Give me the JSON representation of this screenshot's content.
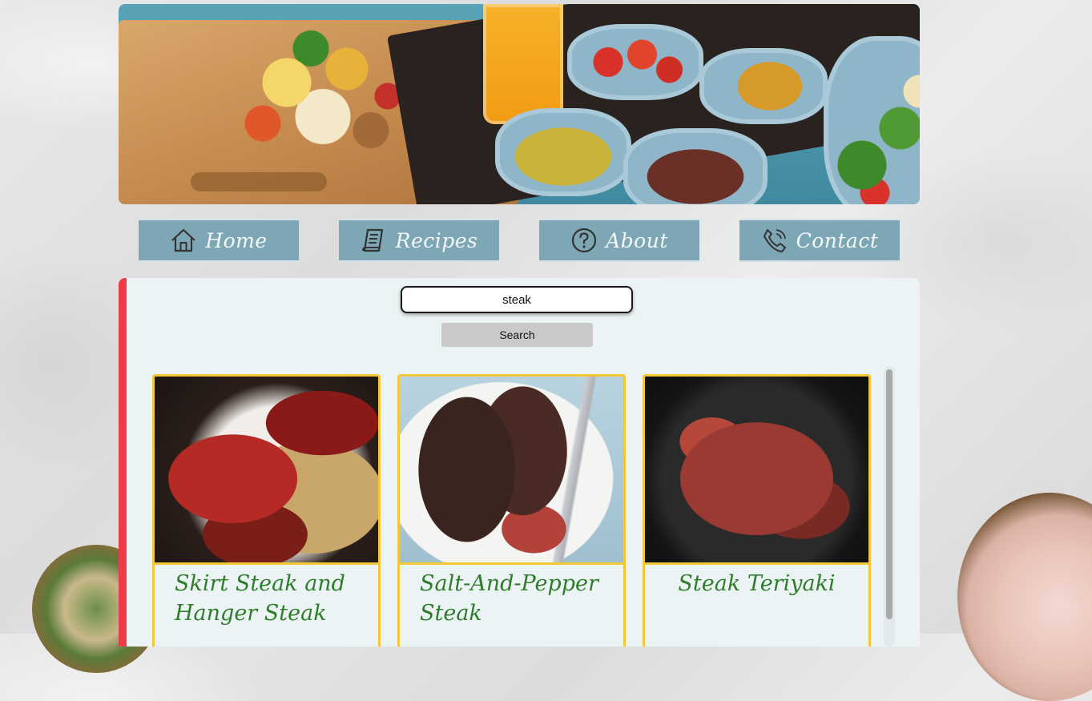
{
  "nav": {
    "items": [
      {
        "label": "Home",
        "icon": "home-icon"
      },
      {
        "label": "Recipes",
        "icon": "recipe-icon"
      },
      {
        "label": "About",
        "icon": "question-icon"
      },
      {
        "label": "Contact",
        "icon": "phone-icon"
      }
    ]
  },
  "search": {
    "value": "steak",
    "button_label": "Search"
  },
  "results": [
    {
      "title": "Skirt Steak and Hanger Steak"
    },
    {
      "title": "Salt-And-Pepper Steak"
    },
    {
      "title": "Steak Teriyaki"
    }
  ],
  "colors": {
    "nav_button": "#7ea7b5",
    "panel_accent": "#ef3b48",
    "card_border": "#f3c737",
    "card_title": "#2e7d2a"
  }
}
